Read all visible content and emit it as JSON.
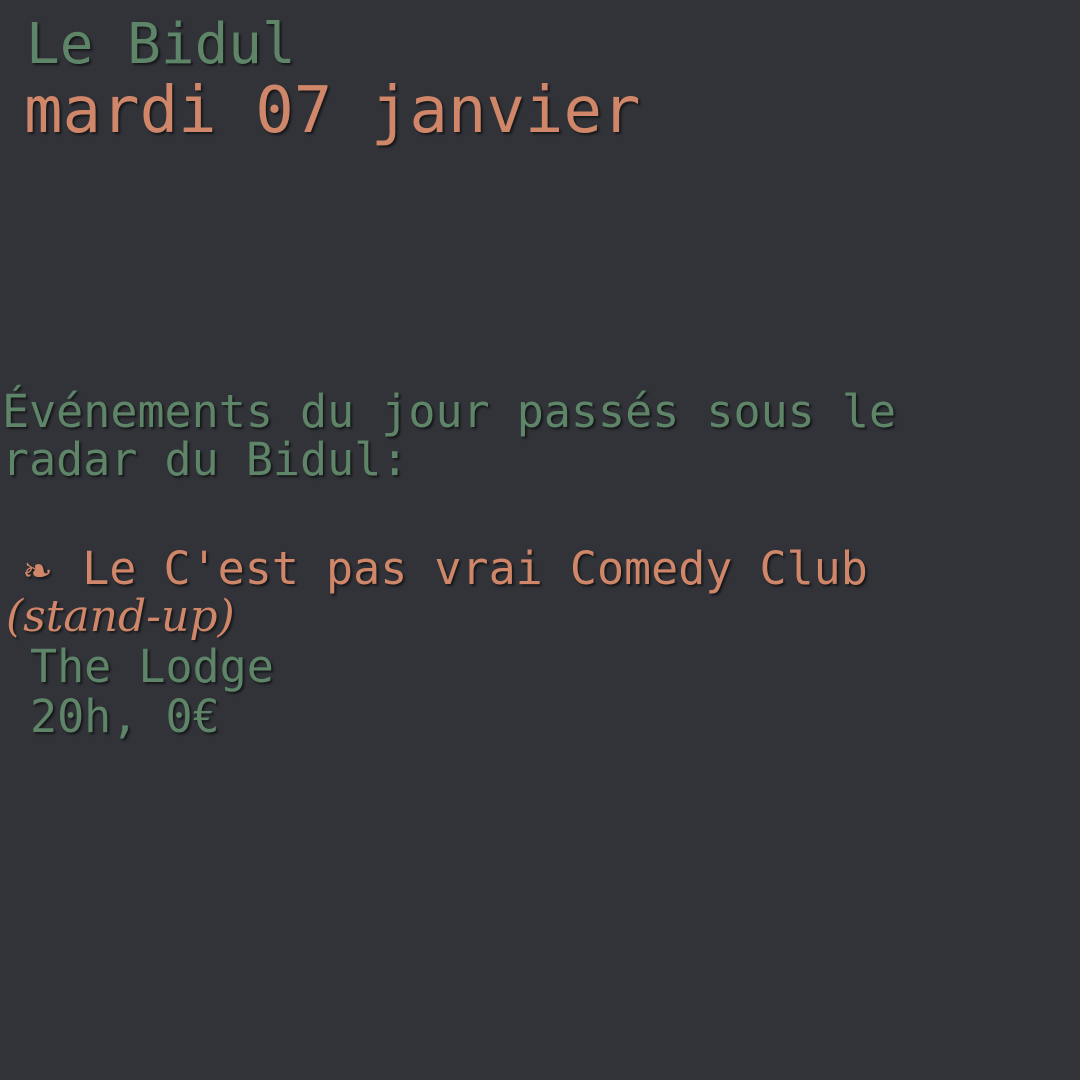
{
  "header": {
    "brand": "Le Bidul",
    "date": "mardi 07 janvier"
  },
  "intro": "Événements du jour passés sous le radar du Bidul:",
  "events": [
    {
      "icon": "❧",
      "title": "Le C'est pas vrai Comedy Club",
      "genre": "(stand-up)",
      "venue": "The Lodge",
      "info": "20h, 0€"
    }
  ],
  "colors": {
    "background": "#313339",
    "green": "#5e8568",
    "orange": "#d08668"
  }
}
